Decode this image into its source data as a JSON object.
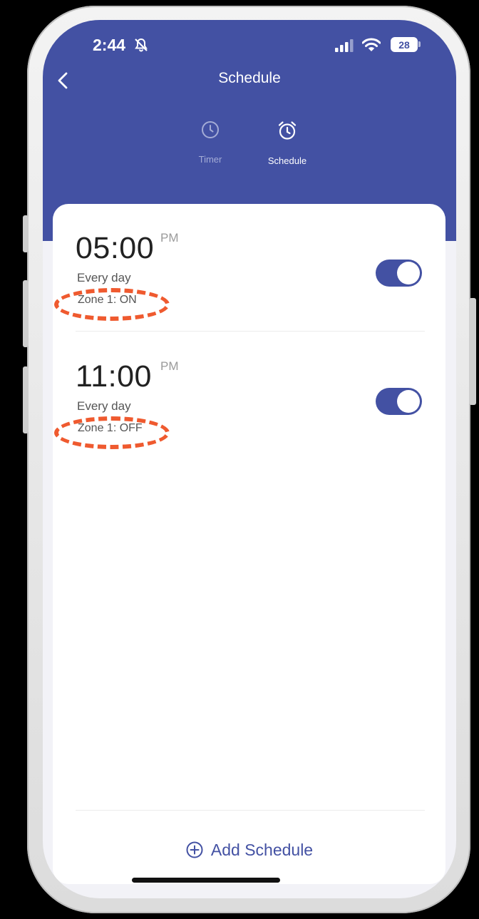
{
  "status_bar": {
    "time": "2:44",
    "battery": "28"
  },
  "nav": {
    "title": "Schedule"
  },
  "tabs": [
    {
      "label": "Timer",
      "active": false
    },
    {
      "label": "Schedule",
      "active": true
    }
  ],
  "schedules": [
    {
      "time": "05:00",
      "ampm": "PM",
      "repeat": "Every day",
      "action": "Zone 1: ON",
      "enabled": true
    },
    {
      "time": "11:00",
      "ampm": "PM",
      "repeat": "Every day",
      "action": "Zone 1: OFF",
      "enabled": true
    }
  ],
  "footer": {
    "add_label": "Add Schedule"
  },
  "colors": {
    "primary": "#4351a3",
    "highlight": "#ef5a2f"
  }
}
